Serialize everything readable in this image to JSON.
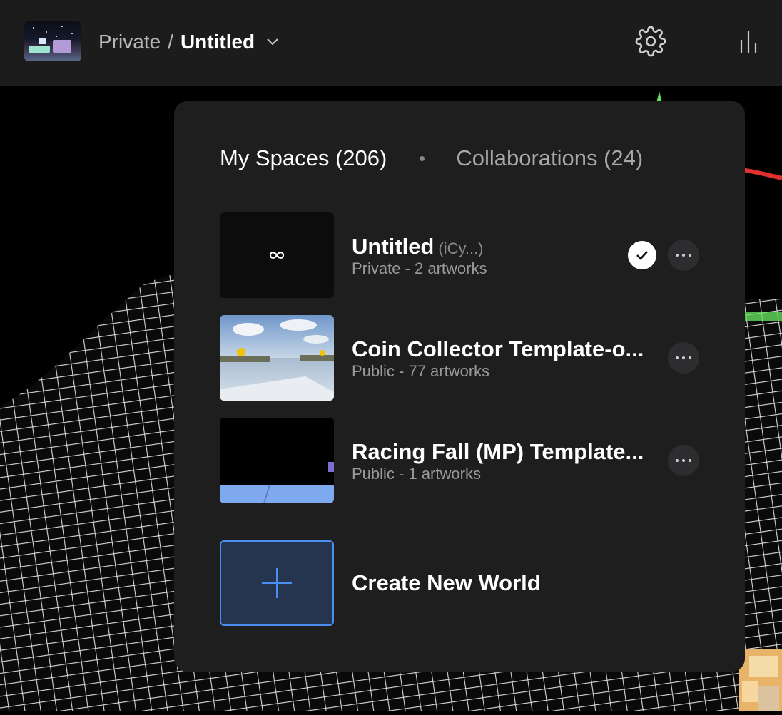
{
  "header": {
    "breadcrumb_visibility": "Private",
    "breadcrumb_separator": "/",
    "breadcrumb_title": "Untitled"
  },
  "dropdown": {
    "tabs": [
      {
        "label": "My Spaces (206)",
        "active": true
      },
      {
        "label": "Collaborations (24)",
        "active": false
      }
    ],
    "worlds": [
      {
        "name": "Untitled",
        "owner": "(iCy...)",
        "meta": "Private - 2 artworks",
        "selected": true,
        "thumb": "infinity-icon"
      },
      {
        "name": "Coin Collector Template-o...",
        "owner": "",
        "meta": "Public - 77 artworks",
        "selected": false,
        "thumb": "sky-scene"
      },
      {
        "name": "Racing Fall (MP) Template...",
        "owner": "",
        "meta": "Public - 1 artworks",
        "selected": false,
        "thumb": "dark-track"
      }
    ],
    "create_label": "Create New World"
  },
  "colors": {
    "accent": "#4a8ef2",
    "panel_bg": "#1e1e1f",
    "topbar_bg": "#1c1c1d"
  }
}
